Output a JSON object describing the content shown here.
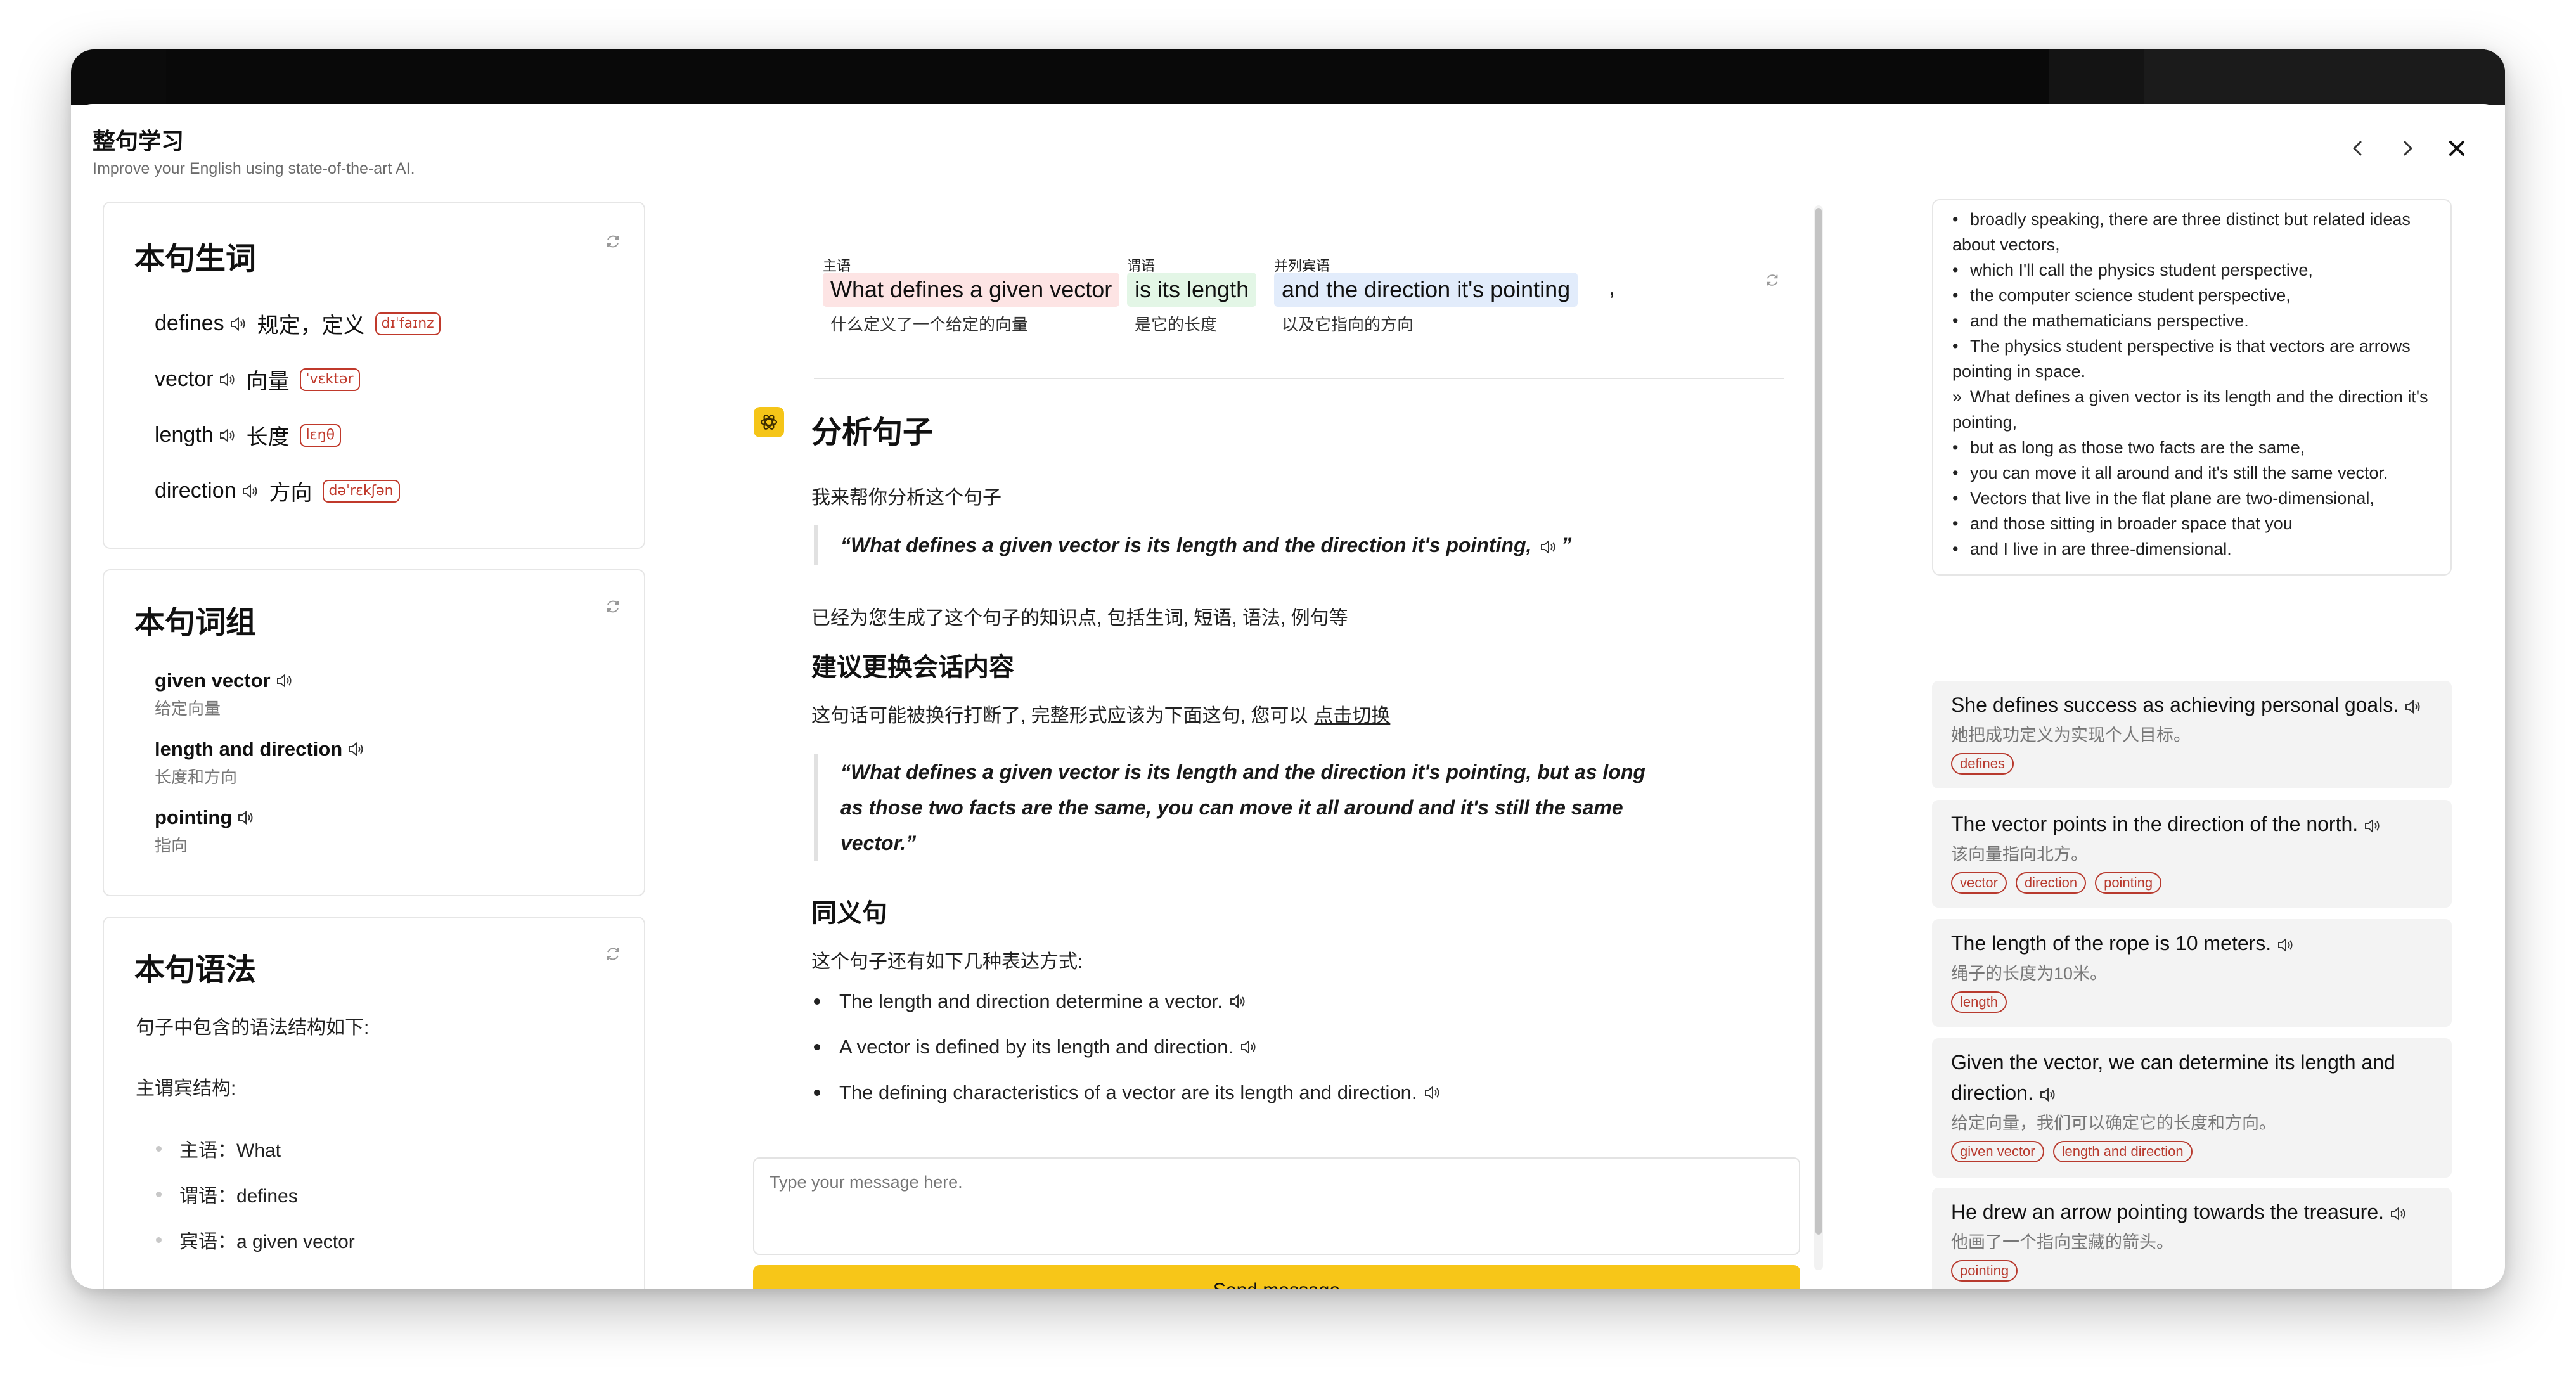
{
  "header": {
    "title": "整句学习",
    "subtitle": "Improve your English using state-of-the-art AI."
  },
  "vocab": {
    "title": "本句生词",
    "items": [
      {
        "word": "defines",
        "meaning": "规定，定义",
        "phonetic": "dɪˈfaɪnz"
      },
      {
        "word": "vector",
        "meaning": "向量",
        "phonetic": "ˈvɛktər"
      },
      {
        "word": "length",
        "meaning": "长度",
        "phonetic": "lɛŋθ"
      },
      {
        "word": "direction",
        "meaning": "方向",
        "phonetic": "dəˈrɛkʃən"
      }
    ]
  },
  "phrases": {
    "title": "本句词组",
    "items": [
      {
        "en": "given vector",
        "zh": "给定向量"
      },
      {
        "en": "length and direction",
        "zh": "长度和方向"
      },
      {
        "en": "pointing",
        "zh": "指向"
      }
    ]
  },
  "grammar": {
    "title": "本句语法",
    "intro": "句子中包含的语法结构如下:",
    "structure": "主谓宾结构:",
    "items": [
      "主语：What",
      "谓语：defines",
      "宾语：a given vector"
    ]
  },
  "sentence": {
    "segments": [
      {
        "label": "主语",
        "text": "What defines a given vector",
        "zh": "什么定义了一个给定的向量",
        "color": "#fde4e4"
      },
      {
        "label": "谓语",
        "text": "is its length",
        "zh": "是它的长度",
        "color": "#e3f6e6"
      },
      {
        "label": "并列宾语",
        "text": "and the direction it's pointing",
        "zh": "以及它指向的方向",
        "color": "#e2ecfb"
      }
    ],
    "trailing": ","
  },
  "analysis": {
    "heading": "分析句子",
    "intro": "我来帮你分析这个句子",
    "quote": "“What defines a given vector is its length and the direction it's pointing,",
    "quote_end": "”",
    "generated": "已经为您生成了这个句子的知识点, 包括生词, 短语, 语法, 例句等",
    "suggest_heading": "建议更换会话内容",
    "suggest_text": "这句话可能被换行打断了, 完整形式应该为下面这句, 您可以",
    "suggest_link": "点击切换",
    "full_quote": "“What defines a given vector is its length and the direction it's pointing, but as long as those two facts are the same, you can move it all around and it's still the same vector.”",
    "syn_heading": "同义句",
    "syn_intro": "这个句子还有如下几种表达方式:",
    "synonyms": [
      "The length and direction determine a vector.",
      "A vector is defined by its length and direction.",
      "The defining characteristics of a vector are its length and direction."
    ]
  },
  "composer": {
    "placeholder": "Type your message here.",
    "send_label": "Send message"
  },
  "transcript": [
    {
      "marker": "•",
      "text": "broadly speaking, there are three distinct but related ideas about vectors,"
    },
    {
      "marker": "•",
      "text": "which I'll call the physics student perspective,"
    },
    {
      "marker": "•",
      "text": "the computer science student perspective,"
    },
    {
      "marker": "•",
      "text": "and the mathematicians perspective."
    },
    {
      "marker": "•",
      "text": "The physics student perspective is that vectors are arrows pointing in space."
    },
    {
      "marker": "»",
      "text": "What defines a given vector is its length and the direction it's pointing,"
    },
    {
      "marker": "•",
      "text": "but as long as those two facts are the same,"
    },
    {
      "marker": "•",
      "text": "you can move it all around and it's still the same vector."
    },
    {
      "marker": "•",
      "text": "Vectors that live in the flat plane are two-dimensional,"
    },
    {
      "marker": "•",
      "text": "and those sitting in broader space that you"
    },
    {
      "marker": "•",
      "text": "and I live in are three-dimensional."
    }
  ],
  "examples": [
    {
      "en": "She defines success as achieving personal goals.",
      "zh": "她把成功定义为实现个人目标。",
      "tags": [
        "defines"
      ]
    },
    {
      "en": "The vector points in the direction of the north.",
      "zh": "该向量指向北方。",
      "tags": [
        "vector",
        "direction",
        "pointing"
      ]
    },
    {
      "en": "The length of the rope is 10 meters.",
      "zh": "绳子的长度为10米。",
      "tags": [
        "length"
      ]
    },
    {
      "en": "Given the vector, we can determine its length and direction.",
      "zh": "给定向量，我们可以确定它的长度和方向。",
      "tags": [
        "given vector",
        "length and direction"
      ]
    },
    {
      "en": "He drew an arrow pointing towards the treasure.",
      "zh": "他画了一个指向宝藏的箭头。",
      "tags": [
        "pointing"
      ]
    }
  ]
}
